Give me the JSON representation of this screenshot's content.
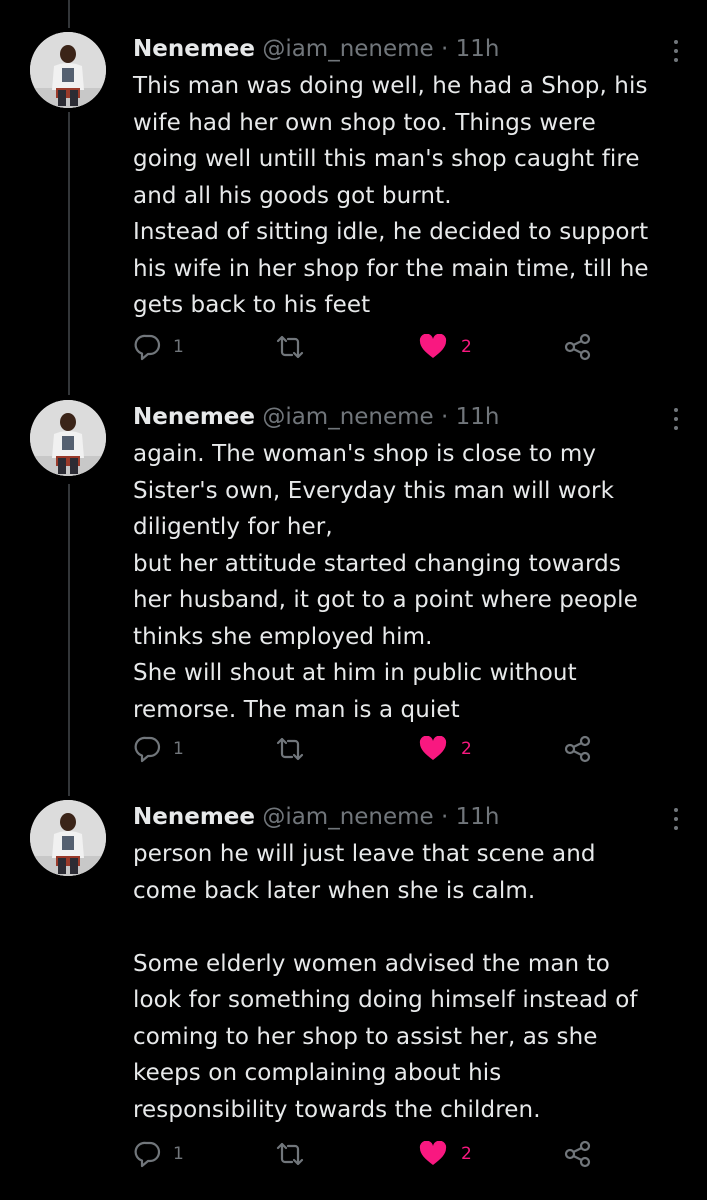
{
  "colors": {
    "background": "#000000",
    "text": "#e7e9ea",
    "secondary": "#71767b",
    "like_active": "#f91880",
    "thread_line": "#333639"
  },
  "tweets": [
    {
      "name": "Nenemee",
      "handle": "@iam_neneme",
      "dot": "·",
      "time": "11h",
      "text": "This man was doing well, he had a Shop, his\nwife had her own shop too. Things were\ngoing well untill this man's shop caught fire\nand all his goods got burnt.\nInstead of sitting idle, he decided to support\nhis wife in her shop for the main time, till he\ngets back to his feet",
      "replies": "1",
      "likes": "2",
      "liked": true,
      "icons": [
        "more-icon",
        "reply-icon",
        "retweet-icon",
        "heart-icon",
        "share-icon"
      ]
    },
    {
      "name": "Nenemee",
      "handle": "@iam_neneme",
      "dot": "·",
      "time": "11h",
      "text": "again. The woman's shop is close to my\nSister's own, Everyday this man will work\ndiligently for her,\nbut her attitude started changing towards\nher husband, it got to a point where people\nthinks she employed him.\nShe will shout at him in public without\nremorse. The man is a quiet",
      "replies": "1",
      "likes": "2",
      "liked": true,
      "icons": [
        "more-icon",
        "reply-icon",
        "retweet-icon",
        "heart-icon",
        "share-icon"
      ]
    },
    {
      "name": "Nenemee",
      "handle": "@iam_neneme",
      "dot": "·",
      "time": "11h",
      "text": "person he will just leave that scene and\ncome back later when she is calm.\n\nSome elderly women advised the man to\nlook for something doing himself instead of\ncoming to her shop to assist her, as she\nkeeps on complaining about his\nresponsibility towards the children.",
      "replies": "1",
      "likes": "2",
      "liked": true,
      "icons": [
        "more-icon",
        "reply-icon",
        "retweet-icon",
        "heart-icon",
        "share-icon"
      ]
    }
  ]
}
